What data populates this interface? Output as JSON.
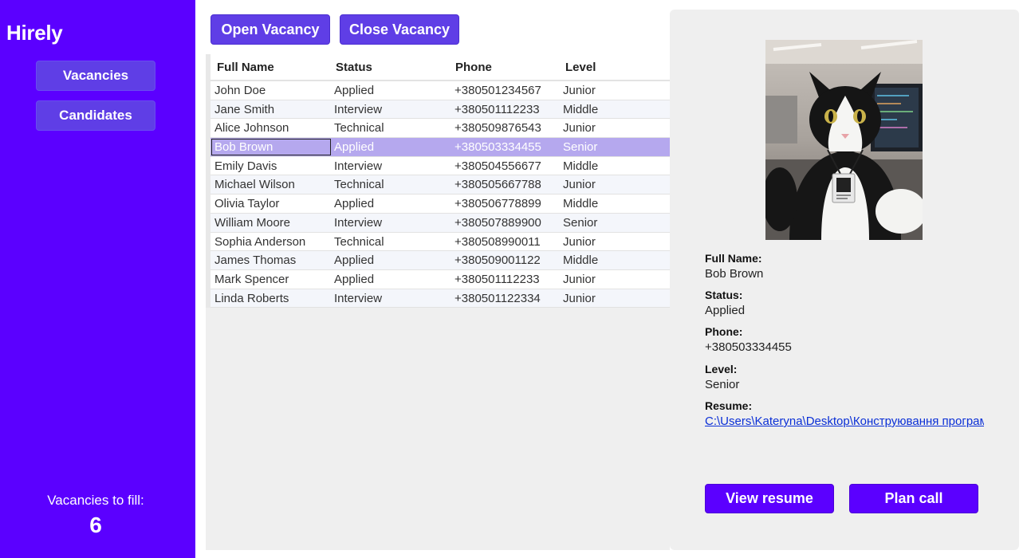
{
  "app": {
    "title": "Hirely"
  },
  "sidebar": {
    "items": [
      {
        "label": "Vacancies"
      },
      {
        "label": "Candidates"
      }
    ],
    "vacancies_label": "Vacancies to fill:",
    "vacancies_count": "6"
  },
  "toolbar": {
    "open_label": "Open Vacancy",
    "close_label": "Close Vacancy"
  },
  "table": {
    "columns": [
      "Full Name",
      "Status",
      "Phone",
      "Level"
    ],
    "selected_index": 3,
    "rows": [
      [
        "John Doe",
        "Applied",
        "+380501234567",
        "Junior"
      ],
      [
        "Jane Smith",
        "Interview",
        "+380501112233",
        "Middle"
      ],
      [
        "Alice Johnson",
        "Technical",
        "+380509876543",
        "Junior"
      ],
      [
        "Bob Brown",
        "Applied",
        "+380503334455",
        "Senior"
      ],
      [
        "Emily Davis",
        "Interview",
        "+380504556677",
        "Middle"
      ],
      [
        "Michael Wilson",
        "Technical",
        "+380505667788",
        "Junior"
      ],
      [
        "Olivia Taylor",
        "Applied",
        "+380506778899",
        "Middle"
      ],
      [
        "William Moore",
        "Interview",
        "+380507889900",
        "Senior"
      ],
      [
        "Sophia Anderson",
        "Technical",
        "+380508990011",
        "Junior"
      ],
      [
        "James Thomas",
        "Applied",
        "+380509001122",
        "Middle"
      ],
      [
        "Mark Spencer",
        "Applied",
        "+380501112233",
        "Junior"
      ],
      [
        "Linda Roberts",
        "Interview",
        "+380501122334",
        "Junior"
      ]
    ]
  },
  "detail": {
    "fullname_label": "Full Name:",
    "fullname": "Bob Brown",
    "status_label": "Status:",
    "status": "Applied",
    "phone_label": "Phone:",
    "phone": "+380503334455",
    "level_label": "Level:",
    "level": "Senior",
    "resume_label": "Resume:",
    "resume_path": "C:\\Users\\Kateryna\\Desktop\\Конструювання програм",
    "view_resume_label": "View resume",
    "plan_call_label": "Plan call"
  },
  "colors": {
    "sidebar": "#5b00ff",
    "button": "#5f3ee6",
    "selection": "#b5a8ee",
    "link": "#0a2fd6"
  }
}
